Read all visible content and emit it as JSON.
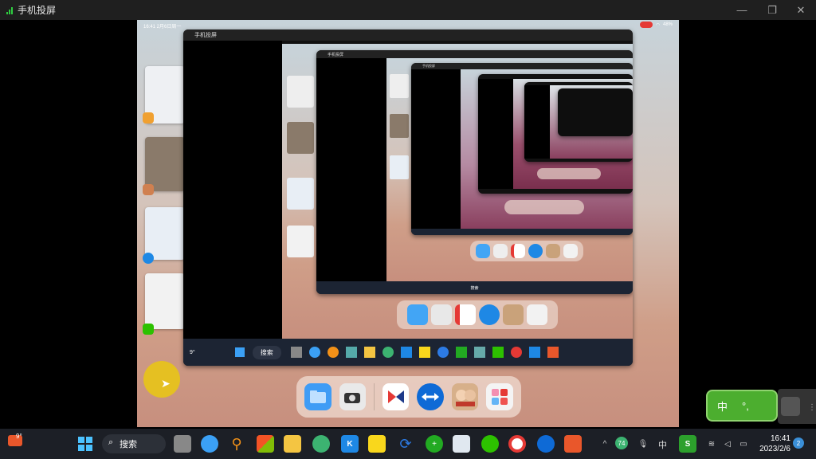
{
  "window": {
    "title": "手机投屏"
  },
  "phone": {
    "status_time": "16:41  2月6日周一",
    "status_right": "48%",
    "nested_title": "手机投屏",
    "nested_taskbar_search": "搜索",
    "weather": "9°",
    "dock_apps": [
      "folder-icon",
      "camera-icon",
      "kuaitui-icon",
      "teamviewer-icon",
      "game-icon",
      "multi-app-icon"
    ]
  },
  "taskbar": {
    "weather_temp": "9°",
    "search_label": "搜索",
    "tray_badge": "74",
    "ime_label": "中",
    "time": "16:41",
    "date": "2023/2/6",
    "notification_count": "2"
  },
  "ime_popup": {
    "label": "中",
    "punct": "°,"
  },
  "colors": {
    "accent": "#0078d4",
    "ime_green": "#4cae2f"
  }
}
